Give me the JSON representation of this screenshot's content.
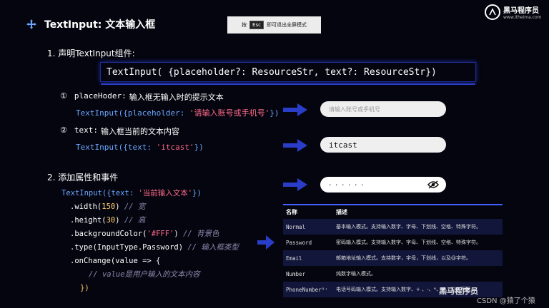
{
  "title": "TextInput: 文本输入框",
  "esc_banner": {
    "prefix": "按",
    "key": "Esc",
    "suffix": "即可退出全屏模式"
  },
  "logo": {
    "name": "黑马程序员",
    "site": "www.itheima.com"
  },
  "section1": {
    "heading": "1. 声明TextInput组件:",
    "signature": "TextInput( {placeholder?: ResourceStr, text?: ResourceStr})"
  },
  "param1": {
    "number": "①",
    "name": "placeHoder:",
    "desc": "输入框无输入时的提示文本",
    "code_open": "TextInput({placeholder: ",
    "code_str": "'请输入账号或手机号'",
    "code_close": "})",
    "demo_placeholder": "请输入账号或手机号"
  },
  "param2": {
    "number": "②",
    "name": "text:",
    "desc": "输入框当前的文本内容",
    "code_open": "TextInput({text: ",
    "code_str": "'itcast'",
    "code_close": "})",
    "demo_value": "itcast"
  },
  "section2": {
    "heading": "2. 添加属性和事件",
    "line1_open": "TextInput({text: ",
    "line1_str": "'当前输入文本'",
    "line1_close": "})",
    "line2_a": ".width(",
    "line2_num": "150",
    "line2_b": ") ",
    "line2_c": "// 宽",
    "line3_a": ".height(",
    "line3_num": "30",
    "line3_b": ") ",
    "line3_c": "// 高",
    "line4_a": ".backgroundColor(",
    "line4_str": "'#FFF'",
    "line4_b": ") ",
    "line4_c": "// 背景色",
    "line5_a": ".type(InputType.Password) ",
    "line5_c": "// 输入框类型",
    "line6_a": ".onChange(value => {",
    "line7_c": "// value是用户输入的文本内容",
    "line8_a": "})"
  },
  "password_demo": {
    "dots": "· · · · · ·",
    "icon": "eye-icon"
  },
  "table": {
    "headers": [
      "名称",
      "描述"
    ],
    "rows": [
      [
        "Normal",
        "基本输入模式。支持输入数字、字母、下划线、空格、特殊字符。"
      ],
      [
        "Password",
        "密码输入模式。支持输入数字、字母、下划线、空格、特殊字符。"
      ],
      [
        "Email",
        "邮箱地址输入模式。支持数字，字母，下划线，以及@字符。"
      ],
      [
        "Number",
        "纯数字输入模式。"
      ],
      [
        "PhoneNumber⁹⁺",
        "电话号码输入模式。支持输入数字、+ 、-、*、#，长度不限。"
      ]
    ]
  },
  "watermark": "黑马程序员",
  "csdn": "CSDN @猿了个猿",
  "colors": {
    "accent": "#2a3dc8",
    "code_blue": "#6aa7ff",
    "code_string": "#ff6a8a",
    "background": "#05050f"
  }
}
